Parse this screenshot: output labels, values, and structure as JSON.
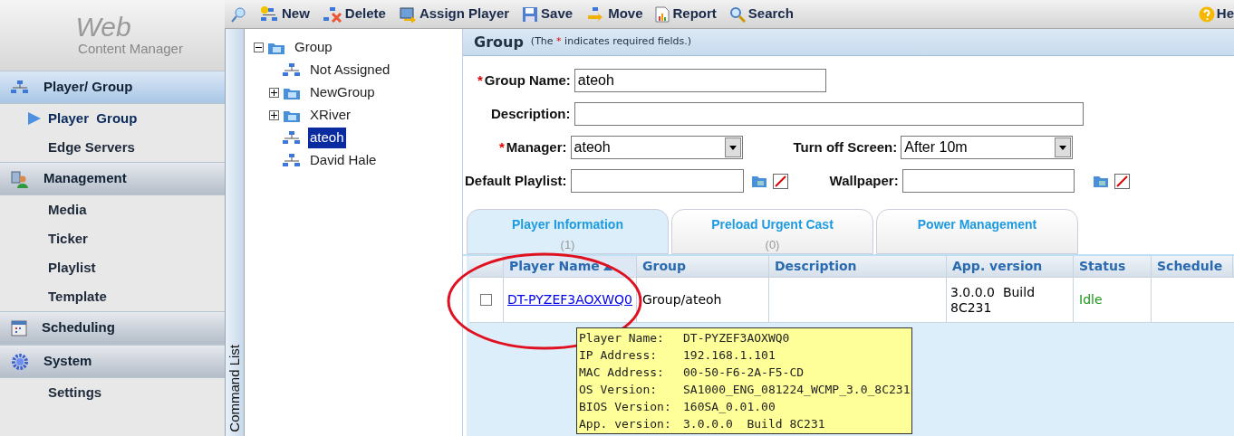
{
  "sidebar": {
    "logo_title": "Web",
    "logo_subtitle": "Content Manager",
    "sections": [
      {
        "label": "Player/ Group",
        "items": [
          {
            "label": "Player  Group",
            "selected": true
          },
          {
            "label": "Edge Servers",
            "selected": false
          }
        ]
      },
      {
        "label": "Management",
        "items": [
          {
            "label": "Media",
            "selected": false
          },
          {
            "label": "Ticker",
            "selected": false
          },
          {
            "label": "Playlist",
            "selected": false
          },
          {
            "label": "Template",
            "selected": false
          }
        ]
      },
      {
        "label": "Scheduling"
      },
      {
        "label": "System",
        "items": [
          {
            "label": "Settings",
            "selected": false
          }
        ]
      }
    ]
  },
  "command_strip": {
    "label": "Command List"
  },
  "toolbar": {
    "buttons": [
      {
        "label": "New"
      },
      {
        "label": "Delete"
      },
      {
        "label": "Assign Player"
      },
      {
        "label": "Save"
      },
      {
        "label": "Move"
      },
      {
        "label": "Report"
      },
      {
        "label": "Search"
      }
    ],
    "help": "He"
  },
  "tree": {
    "label": "Group",
    "kind": "group",
    "expanded": true,
    "selected": false,
    "children": [
      {
        "label": "Not Assigned",
        "kind": "player",
        "selected": false
      },
      {
        "label": "NewGroup",
        "kind": "group",
        "expanded": false,
        "selected": false
      },
      {
        "label": "XRiver",
        "kind": "group",
        "expanded": false,
        "selected": false
      },
      {
        "label": "ateoh",
        "kind": "player",
        "selected": true
      },
      {
        "label": "David Hale",
        "kind": "player",
        "selected": false
      }
    ]
  },
  "form": {
    "title": "Group",
    "note_before": "(The ",
    "note_mark": "*",
    "note_after": " indicates required fields.)",
    "group_name": {
      "label": "Group Name:",
      "required": true,
      "value": "ateoh"
    },
    "description": {
      "label": "Description:",
      "required": false
    },
    "manager": {
      "label": "Manager:",
      "required": true,
      "value": "ateoh"
    },
    "turn_off_screen": {
      "label": "Turn off Screen:",
      "required": false,
      "value": "After 10m"
    },
    "default_playlist": {
      "label": "Default Playlist:",
      "required": false
    },
    "wallpaper": {
      "label": "Wallpaper:",
      "required": false
    }
  },
  "tabs": [
    {
      "label": "Player Information",
      "count": "(1)",
      "selected": true
    },
    {
      "label": "Preload Urgent Cast",
      "count": "(0)",
      "selected": false
    },
    {
      "label": "Power Management",
      "selected": false
    }
  ],
  "table": {
    "columns": [
      {
        "label": "Player Name",
        "sorted": true
      },
      {
        "label": "Group",
        "sorted": false
      },
      {
        "label": "Description",
        "sorted": false
      },
      {
        "label": "App. version",
        "sorted": false
      },
      {
        "label": "Status",
        "sorted": false
      },
      {
        "label": "Schedule",
        "sorted": false
      }
    ],
    "rows": [
      {
        "checked": false,
        "player_name": "DT-PYZEF3AOXWQ0",
        "group": "Group/ateoh",
        "app_version": "3.0.0.0  Build 8C231",
        "status": "Idle"
      }
    ]
  },
  "tooltip": {
    "lines": [
      {
        "label": "Player Name:",
        "value": "DT-PYZEF3AOXWQ0"
      },
      {
        "label": "IP Address:",
        "value": "192.168.1.101"
      },
      {
        "label": "MAC Address:",
        "value": "00-50-F6-2A-F5-CD"
      },
      {
        "label": "OS Version:",
        "value": "SA1000_ENG_081224_WCMP_3.0_8C231"
      },
      {
        "label": "BIOS Version:",
        "value": "160SA_0.01.00"
      },
      {
        "label": "App. version:",
        "value": "3.0.0.0  Build 8C231"
      }
    ]
  }
}
